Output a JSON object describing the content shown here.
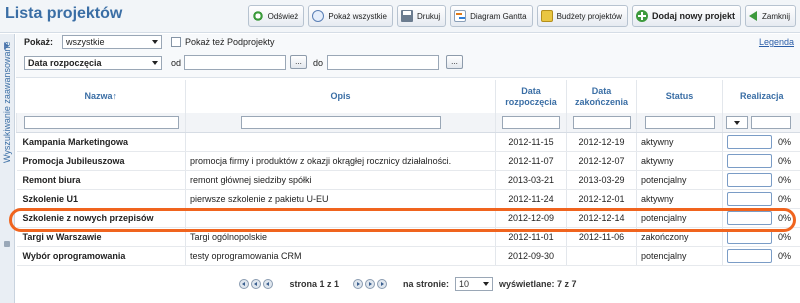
{
  "header": {
    "title": "Lista projektów",
    "buttons": {
      "refresh": "Odśwież",
      "show_all": "Pokaż wszystkie",
      "print": "Drukuj",
      "gantt": "Diagram Gantta",
      "budgets": "Budżety projektów",
      "add_project": "Dodaj nowy projekt",
      "close": "Zamknij"
    }
  },
  "side_tab": {
    "label": "Wyszukiwanie zaawansowane"
  },
  "filters": {
    "show_label": "Pokaż:",
    "show_value": "wszystkie",
    "subprojects_label": "Pokaż też Podprojekty",
    "legend": "Legenda",
    "date_field": "Data rozpoczęcia",
    "from_label": "od",
    "to_label": "do",
    "picker_label": "..."
  },
  "table": {
    "headers": {
      "name": "Nazwa↑",
      "description": "Opis",
      "start": "Data rozpoczęcia",
      "end": "Data zakończenia",
      "status": "Status",
      "progress": "Realizacja"
    },
    "rows": [
      {
        "name": "Kampania Marketingowa",
        "description": "",
        "start": "2012-11-15",
        "end": "2012-12-19",
        "status": "aktywny",
        "progress": 0,
        "progress_label": "0%"
      },
      {
        "name": "Promocja Jubileuszowa",
        "description": "promocja firmy i produktów z okazji okrągłej rocznicy działalności.",
        "start": "2012-11-07",
        "end": "2012-12-07",
        "status": "aktywny",
        "progress": 0,
        "progress_label": "0%"
      },
      {
        "name": "Remont biura",
        "description": "remont głównej siedziby spółki",
        "start": "2013-03-21",
        "end": "2013-03-29",
        "status": "potencjalny",
        "progress": 0,
        "progress_label": "0%"
      },
      {
        "name": "Szkolenie U1",
        "description": "pierwsze szkolenie z pakietu U-EU",
        "start": "2012-11-24",
        "end": "2012-12-01",
        "status": "aktywny",
        "progress": 0,
        "progress_label": "0%"
      },
      {
        "name": "Szkolenie z nowych przepisów",
        "description": "",
        "start": "2012-12-09",
        "end": "2012-12-14",
        "status": "potencjalny",
        "progress": 0,
        "progress_label": "0%"
      },
      {
        "name": "Targi w Warszawie",
        "description": "Targi ogólnopolskie",
        "start": "2012-11-01",
        "end": "2012-11-06",
        "status": "zakończony",
        "progress": 0,
        "progress_label": "0%"
      },
      {
        "name": "Wybór oprogramowania",
        "description": "testy oprogramowania CRM",
        "start": "2012-09-30",
        "end": "",
        "status": "potencjalny",
        "progress": 0,
        "progress_label": "0%"
      }
    ]
  },
  "pager": {
    "page_text": "strona 1 z 1",
    "per_page_label": "na stronie:",
    "per_page_value": "10",
    "shown_text": "wyświetlane: 7 z 7"
  }
}
